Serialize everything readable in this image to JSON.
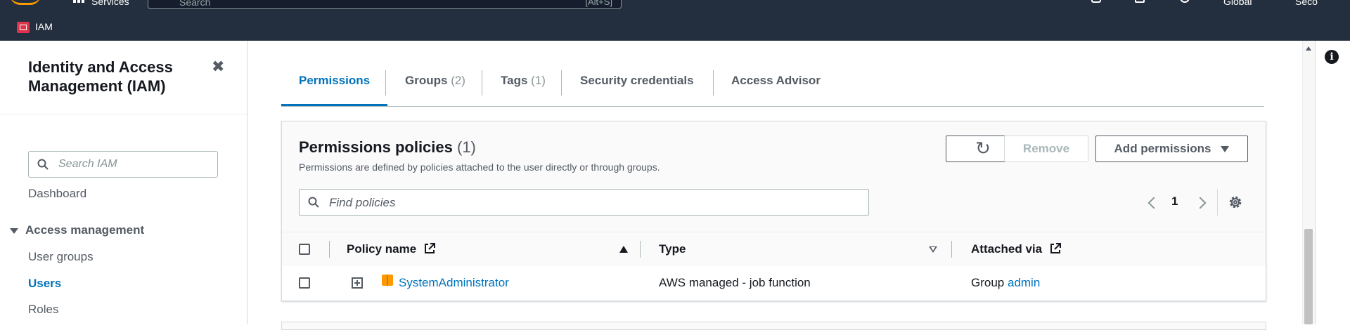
{
  "topnav": {
    "services_label": "Services",
    "search_placeholder": "Search",
    "search_shortcut": "[Alt+S]",
    "region_label": "Global",
    "account_label": "Seco",
    "breadcrumb_service": "IAM"
  },
  "sidebar": {
    "title": "Identity and Access Management (IAM)",
    "close_glyph": "✖",
    "search_placeholder": "Search IAM",
    "dashboard": "Dashboard",
    "section_access": "Access management",
    "items": [
      "User groups",
      "Users",
      "Roles"
    ]
  },
  "tabs": [
    {
      "label": "Permissions",
      "count": ""
    },
    {
      "label": "Groups",
      "count": "(2)"
    },
    {
      "label": "Tags",
      "count": "(1)"
    },
    {
      "label": "Security credentials",
      "count": ""
    },
    {
      "label": "Access Advisor",
      "count": ""
    }
  ],
  "permissions": {
    "title": "Permissions policies",
    "count": "(1)",
    "description": "Permissions are defined by policies attached to the user directly or through groups.",
    "refresh_glyph": "↻",
    "remove_label": "Remove",
    "add_label": "Add permissions",
    "filter_placeholder": "Find policies",
    "page_number": "1",
    "columns": [
      "Policy name",
      "Type",
      "Attached via"
    ],
    "rows": [
      {
        "name": "SystemAdministrator",
        "type": "AWS managed - job function",
        "attached_prefix": "Group",
        "attached_link": "admin"
      }
    ]
  },
  "colors": {
    "nav_bg": "#232f3e",
    "accent": "#0073bb",
    "aws_orange": "#ff9900"
  }
}
